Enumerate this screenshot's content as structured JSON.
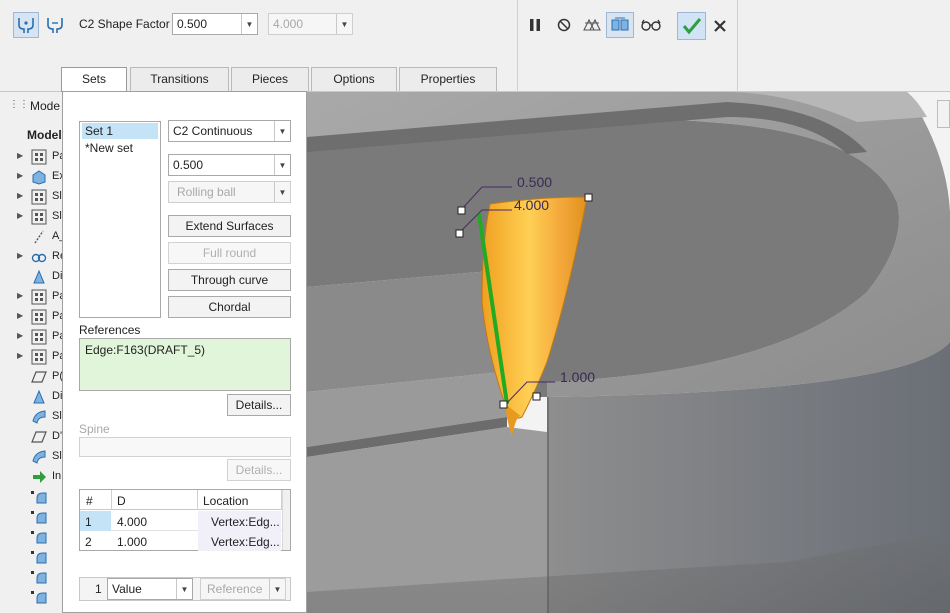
{
  "ribbon": {
    "shape_factor_label": "C2 Shape Factor",
    "shape_factor_value": "0.500",
    "secondary_value": "4.000",
    "icons": [
      "round-set-icon",
      "round-transition-icon",
      "pause-icon",
      "no-preview-icon",
      "preview-icon",
      "verify-icon",
      "glasses-icon",
      "ok-check-icon",
      "cancel-x-icon"
    ]
  },
  "tabs": [
    {
      "label": "Sets"
    },
    {
      "label": "Transitions"
    },
    {
      "label": "Pieces"
    },
    {
      "label": "Options"
    },
    {
      "label": "Properties"
    }
  ],
  "tree": {
    "header_label": "Mode",
    "subheader_label": "Model",
    "rows": [
      {
        "label": "Pa",
        "icon": "pattern-icon",
        "expandable": true
      },
      {
        "label": "Ex",
        "icon": "extrude-icon",
        "expandable": true
      },
      {
        "label": "Sl",
        "icon": "pattern-icon",
        "expandable": true
      },
      {
        "label": "Sl",
        "icon": "pattern-icon",
        "expandable": true
      },
      {
        "label": "A_",
        "icon": "axis-icon",
        "expandable": false
      },
      {
        "label": "Re",
        "icon": "revolve-icon",
        "expandable": true
      },
      {
        "label": "Di",
        "icon": "draft-icon",
        "expandable": false
      },
      {
        "label": "Pa",
        "icon": "pattern-icon",
        "expandable": true
      },
      {
        "label": "Pa",
        "icon": "pattern-icon",
        "expandable": true
      },
      {
        "label": "Pa",
        "icon": "pattern-icon",
        "expandable": true
      },
      {
        "label": "Pa",
        "icon": "pattern-icon",
        "expandable": true
      },
      {
        "label": "P(",
        "icon": "plane-icon",
        "expandable": false
      },
      {
        "label": "Di",
        "icon": "draft-icon",
        "expandable": false
      },
      {
        "label": "Sl",
        "icon": "surface-icon",
        "expandable": false
      },
      {
        "label": "D'",
        "icon": "plane-icon",
        "expandable": false
      },
      {
        "label": "Sl",
        "icon": "surface-icon",
        "expandable": false
      },
      {
        "label": "In",
        "icon": "insert-arrow-icon",
        "expandable": false
      },
      {
        "label": "",
        "icon": "round-icon",
        "expandable": false
      },
      {
        "label": "",
        "icon": "round-icon",
        "expandable": false
      },
      {
        "label": "",
        "icon": "round-icon",
        "expandable": false
      },
      {
        "label": "",
        "icon": "round-icon",
        "expandable": false
      },
      {
        "label": "",
        "icon": "round-icon",
        "expandable": false
      },
      {
        "label": "",
        "icon": "round-icon",
        "expandable": false
      }
    ]
  },
  "panel": {
    "sets": [
      {
        "label": "Set 1",
        "selected": true
      },
      {
        "label": "*New set",
        "selected": false
      }
    ],
    "continuity": "C2 Continuous",
    "shape_value": "0.500",
    "rolling_ball": "Rolling ball",
    "buttons": {
      "extend_surfaces": "Extend Surfaces",
      "full_round": "Full round",
      "through_curve": "Through curve",
      "chordal": "Chordal"
    },
    "references_label": "References",
    "reference_value": "Edge:F163(DRAFT_5)",
    "details_label": "Details...",
    "spine_label": "Spine",
    "spine_details_label": "Details...",
    "table": {
      "headers": [
        "#",
        "D",
        "Location"
      ],
      "rows": [
        {
          "num": "1",
          "d": "4.000",
          "location": "Vertex:Edg..."
        },
        {
          "num": "2",
          "d": "1.000",
          "location": "Vertex:Edg..."
        }
      ]
    },
    "footer": {
      "count": "1",
      "mode": "Value",
      "reference": "Reference"
    }
  },
  "viewport": {
    "dim_labels": [
      "0.500",
      "4.000",
      "1.000"
    ],
    "colors": {
      "surface": "#f5a623",
      "highlight_edge": "#22aa22",
      "model_gray": "#7a7a7a",
      "dim_line": "#4a2a6a"
    }
  }
}
